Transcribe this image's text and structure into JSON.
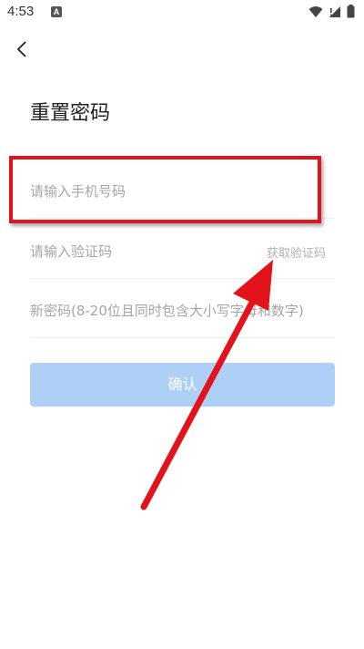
{
  "status_bar": {
    "time": "4:53",
    "notification_letter": "A",
    "icons": [
      "wifi-icon",
      "signal-icon",
      "battery-icon"
    ]
  },
  "nav": {
    "back_icon": "back-chevron-icon"
  },
  "page": {
    "title": "重置密码",
    "phone_placeholder": "请输入手机号码",
    "code_placeholder": "请输入验证码",
    "get_code_label": "获取验证码",
    "password_placeholder": "新密码(8-20位且同时包含大小写字母和数字)",
    "confirm_label": "确认"
  },
  "colors": {
    "confirm_button_bg": "#aed0f6",
    "annotation_red": "#e3131b",
    "placeholder": "#a6a6a6"
  }
}
